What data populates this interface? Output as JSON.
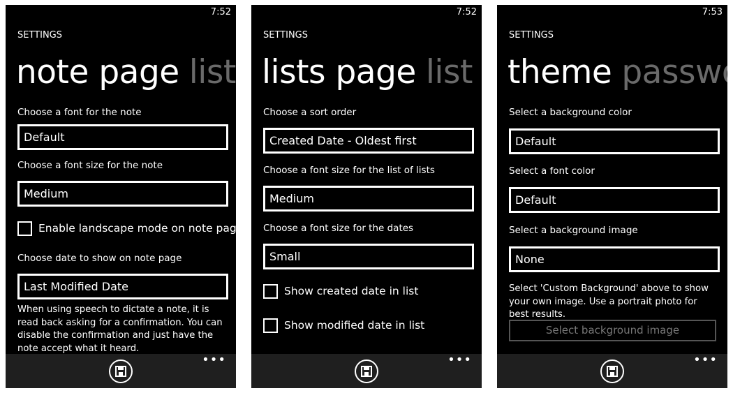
{
  "screens": [
    {
      "time": "7:52",
      "header": "SETTINGS",
      "pivot_active": "note page",
      "pivot_next": "lists",
      "font_label": "Choose a font for the note",
      "font_value": "Default",
      "size_label": "Choose a font size for the note",
      "size_value": "Medium",
      "landscape_label": "Enable landscape mode on note page",
      "date_label": "Choose date to show on note page",
      "date_value": "Last Modified Date",
      "speech_text": "When using speech to dictate a note, it is read back asking for a confirmation.  You can disable the confirmation and just have the note accept what it heard.",
      "more": "•••"
    },
    {
      "time": "7:52",
      "header": "SETTINGS",
      "pivot_active": "lists page",
      "pivot_next": "list p",
      "sort_label": "Choose a sort order",
      "sort_value": "Created Date - Oldest first",
      "lists_size_label": "Choose a font size for the list of lists",
      "lists_size_value": "Medium",
      "dates_size_label": "Choose a font size for the dates",
      "dates_size_value": "Small",
      "show_created_label": "Show created date in list",
      "show_modified_label": "Show modified date in list",
      "more": "•••"
    },
    {
      "time": "7:53",
      "header": "SETTINGS",
      "pivot_active": "theme",
      "pivot_next": "passwor",
      "bg_color_label": "Select a background color",
      "bg_color_value": "Default",
      "font_color_label": "Select a font color",
      "font_color_value": "Default",
      "bg_image_label": "Select a background image",
      "bg_image_value": "None",
      "bg_hint": "Select 'Custom Background' above to show your own image.  Use a portrait photo for best results.",
      "select_bg_button": "Select background image",
      "more": "•••"
    }
  ]
}
